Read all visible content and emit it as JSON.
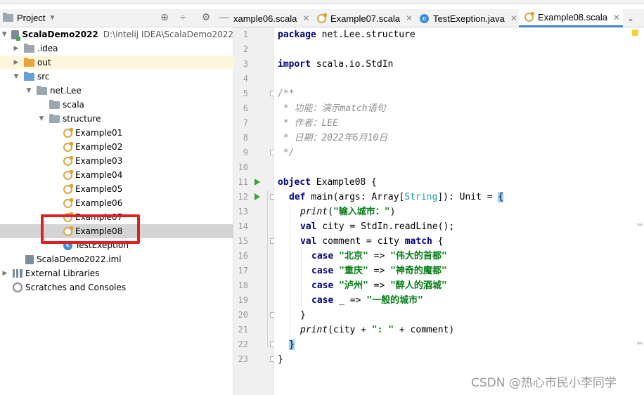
{
  "project_panel": {
    "title": "Project",
    "tree": [
      {
        "label": "ScalaDemo2022",
        "hint": "D:\\intelij IDEA\\ScalaDemo2022",
        "icon": "module-folder-icon"
      },
      {
        "label": ".idea",
        "icon": "folder-icon"
      },
      {
        "label": "out",
        "icon": "folder-icon"
      },
      {
        "label": "src",
        "icon": "source-folder-icon"
      },
      {
        "label": "net.Lee",
        "icon": "package-icon"
      },
      {
        "label": "scala",
        "icon": "package-icon"
      },
      {
        "label": "structure",
        "icon": "package-icon"
      },
      {
        "label": "Example01",
        "icon": "scala-object-icon"
      },
      {
        "label": "Example02",
        "icon": "scala-object-icon"
      },
      {
        "label": "Example03",
        "icon": "scala-object-icon"
      },
      {
        "label": "Example04",
        "icon": "scala-object-icon"
      },
      {
        "label": "Example05",
        "icon": "scala-object-icon"
      },
      {
        "label": "Example06",
        "icon": "scala-object-icon"
      },
      {
        "label": "Example07",
        "icon": "scala-object-icon"
      },
      {
        "label": "Example08",
        "icon": "scala-object-icon",
        "selected": true
      },
      {
        "label": "TestExeption",
        "icon": "java-class-icon"
      },
      {
        "label": "ScalaDemo2022.iml",
        "icon": "iml-file-icon"
      },
      {
        "label": "External Libraries",
        "icon": "libraries-icon"
      },
      {
        "label": "Scratches and Consoles",
        "icon": "scratches-icon"
      }
    ]
  },
  "tabs": [
    {
      "label": "xample06.scala",
      "icon": "scala-object-icon"
    },
    {
      "label": "Example07.scala",
      "icon": "scala-object-icon"
    },
    {
      "label": "TestExeption.java",
      "icon": "java-class-icon"
    },
    {
      "label": "Example08.scala",
      "icon": "scala-object-icon",
      "active": true
    }
  ],
  "editor": {
    "line_numbers": [
      "1",
      "2",
      "3",
      "4",
      "5",
      "6",
      "7",
      "8",
      "9",
      "10",
      "11",
      "12",
      "13",
      "14",
      "15",
      "16",
      "17",
      "18",
      "19",
      "20",
      "21",
      "22",
      "23"
    ],
    "code": {
      "l1_kw": "package",
      "l1_rest": " net.Lee.structure",
      "l3_kw": "import",
      "l3_rest": " scala.io.StdIn",
      "l5": "/**",
      "l6": " * 功能：演示match语句",
      "l7": " * 作者：LEE",
      "l8": " * 日期：2022年6月10日",
      "l9": " */",
      "l11_kw": "object",
      "l11_rest": " Example08 {",
      "l12_kw": "def",
      "l12_a": " main(args: Array[",
      "l12_type": "String",
      "l12_b": "]): Unit = ",
      "l12_brace": "{",
      "l13_fn": "print",
      "l13_a": "(",
      "l13_str": "\"输入城市：\"",
      "l13_b": ")",
      "l14_kw": "val",
      "l14_rest": " city = StdIn.readLine();",
      "l15_kw": "val",
      "l15_a": " comment = city ",
      "l15_kw2": "match",
      "l15_b": " {",
      "l16_kw": "case",
      "l16_s1": "\"北京\"",
      "l16_arrow": " => ",
      "l16_s2": "\"伟大的首都\"",
      "l17_kw": "case",
      "l17_s1": "\"重庆\"",
      "l17_arrow": " => ",
      "l17_s2": "\"神奇的魔都\"",
      "l18_kw": "case",
      "l18_s1": "\"泸州\"",
      "l18_arrow": " => ",
      "l18_s2": "\"醉人的酒城\"",
      "l19_kw": "case",
      "l19_a": " _ => ",
      "l19_s": "\"一般的城市\"",
      "l20": "}",
      "l21_fn": "print",
      "l21_a": "(city + ",
      "l21_str": "\": \"",
      "l21_b": " + comment)",
      "l22": "}",
      "l23": "}"
    }
  },
  "watermark": "CSDN @热心市民小李同学",
  "colors": {
    "keyword": "#000080",
    "string": "#067d17",
    "comment": "#8c8c8c",
    "selection": "#d4d4d4",
    "annotation_box": "#e02020",
    "active_tab_underline": "#4083c9"
  }
}
